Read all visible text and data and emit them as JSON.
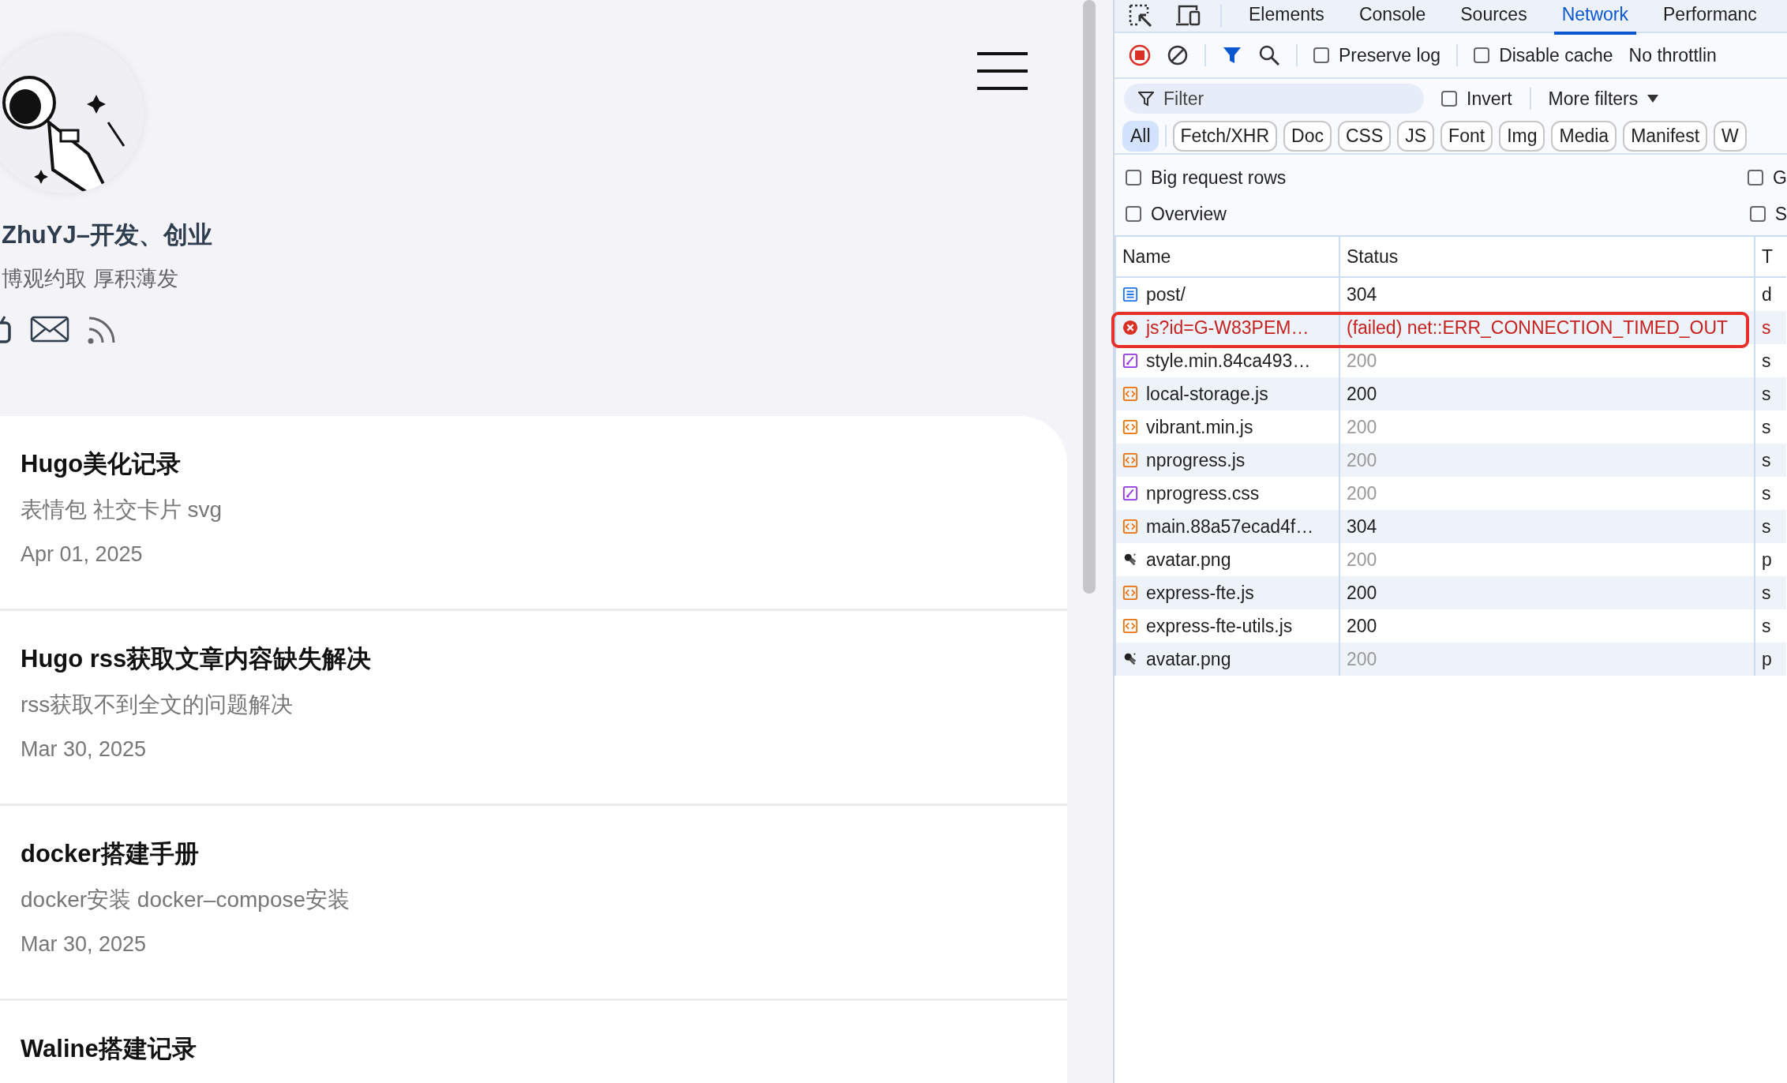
{
  "blog": {
    "author": "ZhuYJ–开发、创业",
    "motto": "博观约取 厚积薄发",
    "posts": [
      {
        "title": "Hugo美化记录",
        "summary": "表情包 社交卡片 svg",
        "date": "Apr 01, 2025"
      },
      {
        "title": "Hugo rss获取文章内容缺失解决",
        "summary": "rss获取不到全文的问题解决",
        "date": "Mar 30, 2025"
      },
      {
        "title": "docker搭建手册",
        "summary": "docker安装 docker–compose安装",
        "date": "Mar 30, 2025"
      },
      {
        "title": "Waline搭建记录"
      }
    ]
  },
  "devtools": {
    "tabs": [
      {
        "label": "Elements",
        "selected": false
      },
      {
        "label": "Console",
        "selected": false
      },
      {
        "label": "Sources",
        "selected": false
      },
      {
        "label": "Network",
        "selected": true
      },
      {
        "label": "Performanc",
        "selected": false
      }
    ],
    "toolbar": {
      "recording": true,
      "filter_active": true,
      "checkboxes": [
        {
          "label": "Preserve log",
          "checked": false
        },
        {
          "label": "Disable cache",
          "checked": false
        }
      ],
      "throttling": "No throttlin"
    },
    "filter": {
      "placeholder": "Filter",
      "invert": {
        "label": "Invert",
        "checked": false
      },
      "more_filters": "More filters"
    },
    "type_filters": [
      {
        "label": "All",
        "selected": true
      },
      {
        "label": "Fetch/XHR",
        "selected": false
      },
      {
        "label": "Doc",
        "selected": false
      },
      {
        "label": "CSS",
        "selected": false
      },
      {
        "label": "JS",
        "selected": false
      },
      {
        "label": "Font",
        "selected": false
      },
      {
        "label": "Img",
        "selected": false
      },
      {
        "label": "Media",
        "selected": false
      },
      {
        "label": "Manifest",
        "selected": false
      },
      {
        "label": "W",
        "selected": false
      }
    ],
    "options": [
      {
        "label": "Big request rows",
        "checked": false,
        "right_label": "G",
        "right_checked": false
      },
      {
        "label": "Overview",
        "checked": false,
        "right_label": "S",
        "right_checked": false
      }
    ],
    "table": {
      "columns": [
        "Name",
        "Status",
        "T"
      ],
      "rows": [
        {
          "kind": "document",
          "name": "post/",
          "status": "304",
          "column_3": "d",
          "failed": false,
          "greyed": false,
          "highlighted": false
        },
        {
          "kind": "error",
          "name": "js?id=G-W83PEM…",
          "status": "(failed) net::ERR_CONNECTION_TIMED_OUT",
          "column_3": "s",
          "failed": true,
          "greyed": false,
          "highlighted": true
        },
        {
          "kind": "stylesheet",
          "name": "style.min.84ca493…",
          "status": "200",
          "column_3": "s",
          "failed": false,
          "greyed": true,
          "highlighted": false
        },
        {
          "kind": "script",
          "name": "local-storage.js",
          "status": "200",
          "column_3": "s",
          "failed": false,
          "greyed": false,
          "highlighted": false
        },
        {
          "kind": "script",
          "name": "vibrant.min.js",
          "status": "200",
          "column_3": "s",
          "failed": false,
          "greyed": true,
          "highlighted": false
        },
        {
          "kind": "script",
          "name": "nprogress.js",
          "status": "200",
          "column_3": "s",
          "failed": false,
          "greyed": true,
          "highlighted": false
        },
        {
          "kind": "stylesheet",
          "name": "nprogress.css",
          "status": "200",
          "column_3": "s",
          "failed": false,
          "greyed": true,
          "highlighted": false
        },
        {
          "kind": "script",
          "name": "main.88a57ecad4f…",
          "status": "304",
          "column_3": "s",
          "failed": false,
          "greyed": false,
          "highlighted": false
        },
        {
          "kind": "image",
          "name": "avatar.png",
          "status": "200",
          "column_3": "p",
          "failed": false,
          "greyed": true,
          "highlighted": false
        },
        {
          "kind": "script",
          "name": "express-fte.js",
          "status": "200",
          "column_3": "s",
          "failed": false,
          "greyed": false,
          "highlighted": false
        },
        {
          "kind": "script",
          "name": "express-fte-utils.js",
          "status": "200",
          "column_3": "s",
          "failed": false,
          "greyed": false,
          "highlighted": false
        },
        {
          "kind": "image",
          "name": "avatar.png",
          "status": "200",
          "column_3": "p",
          "failed": false,
          "greyed": true,
          "highlighted": false
        }
      ]
    }
  }
}
